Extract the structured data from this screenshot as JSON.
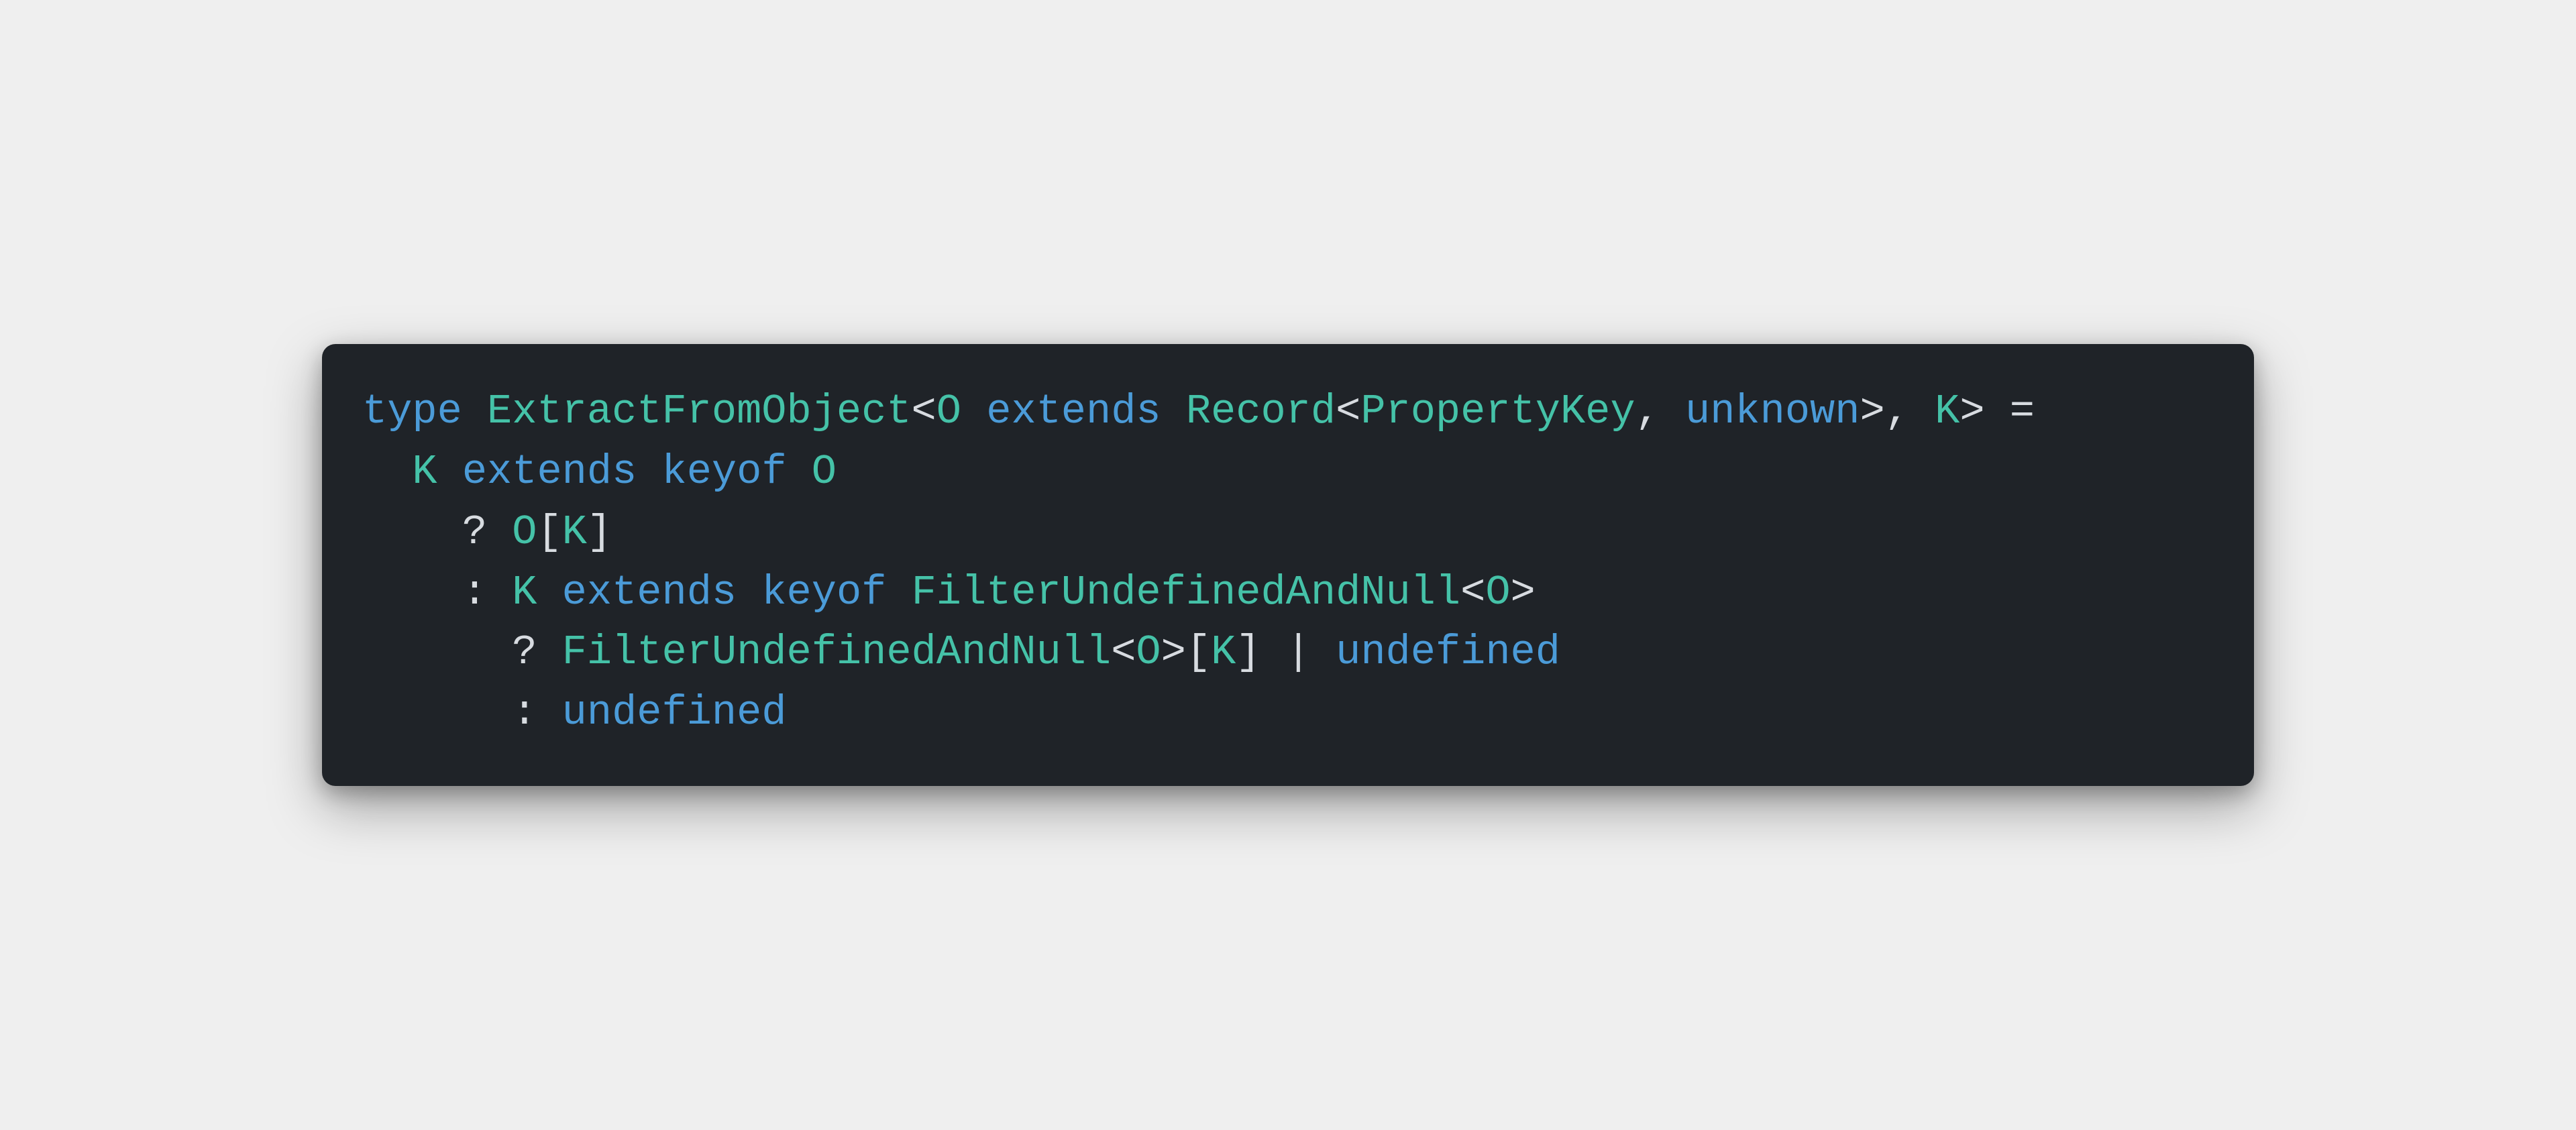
{
  "colors": {
    "background_page": "#efefef",
    "background_card": "#1f2328",
    "keyword": "#4b9bd8",
    "type": "#45c2a8",
    "builtin": "#4b9bd8",
    "punct": "#d7dbe0"
  },
  "code": {
    "lines": [
      [
        {
          "t": "type ",
          "c": "keyword"
        },
        {
          "t": "ExtractFromObject",
          "c": "type"
        },
        {
          "t": "<",
          "c": "punct"
        },
        {
          "t": "O",
          "c": "typeparam"
        },
        {
          "t": " extends ",
          "c": "keyword"
        },
        {
          "t": "Record",
          "c": "type"
        },
        {
          "t": "<",
          "c": "punct"
        },
        {
          "t": "PropertyKey",
          "c": "type"
        },
        {
          "t": ", ",
          "c": "punct"
        },
        {
          "t": "unknown",
          "c": "builtin"
        },
        {
          "t": ">, ",
          "c": "punct"
        },
        {
          "t": "K",
          "c": "typeparam"
        },
        {
          "t": "> =",
          "c": "punct"
        }
      ],
      [
        {
          "t": "  ",
          "c": "punct"
        },
        {
          "t": "K",
          "c": "typeparam"
        },
        {
          "t": " extends keyof ",
          "c": "keyword"
        },
        {
          "t": "O",
          "c": "typeparam"
        }
      ],
      [
        {
          "t": "    ? ",
          "c": "punct"
        },
        {
          "t": "O",
          "c": "typeparam"
        },
        {
          "t": "[",
          "c": "punct"
        },
        {
          "t": "K",
          "c": "typeparam"
        },
        {
          "t": "]",
          "c": "punct"
        }
      ],
      [
        {
          "t": "    : ",
          "c": "punct"
        },
        {
          "t": "K",
          "c": "typeparam"
        },
        {
          "t": " extends keyof ",
          "c": "keyword"
        },
        {
          "t": "FilterUndefinedAndNull",
          "c": "type"
        },
        {
          "t": "<",
          "c": "punct"
        },
        {
          "t": "O",
          "c": "typeparam"
        },
        {
          "t": ">",
          "c": "punct"
        }
      ],
      [
        {
          "t": "      ? ",
          "c": "punct"
        },
        {
          "t": "FilterUndefinedAndNull",
          "c": "type"
        },
        {
          "t": "<",
          "c": "punct"
        },
        {
          "t": "O",
          "c": "typeparam"
        },
        {
          "t": ">[",
          "c": "punct"
        },
        {
          "t": "K",
          "c": "typeparam"
        },
        {
          "t": "] | ",
          "c": "punct"
        },
        {
          "t": "undefined",
          "c": "builtin"
        }
      ],
      [
        {
          "t": "      : ",
          "c": "punct"
        },
        {
          "t": "undefined",
          "c": "builtin"
        }
      ]
    ]
  }
}
